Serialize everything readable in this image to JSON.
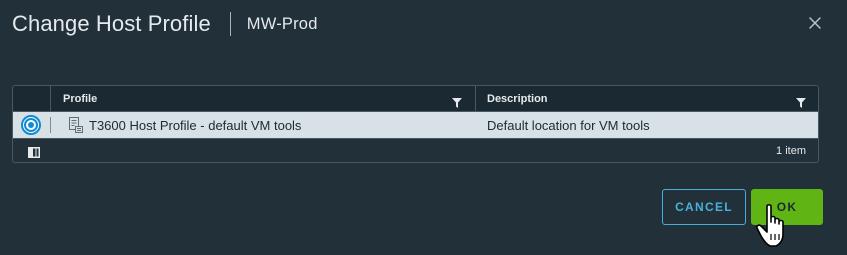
{
  "dialog": {
    "title": "Change Host Profile",
    "subtitle": "MW-Prod",
    "close_icon": "close-icon"
  },
  "grid": {
    "columns": [
      {
        "label": "Profile",
        "filter_icon": "filter-icon"
      },
      {
        "label": "Description",
        "filter_icon": "filter-icon"
      }
    ],
    "rows": [
      {
        "selected": true,
        "icon": "host-profile-icon",
        "profile": "T3600 Host Profile - default VM tools",
        "description": "Default location for VM tools"
      }
    ],
    "footer": {
      "columns_toggle_icon": "column-toggle-icon",
      "item_count": "1 item"
    }
  },
  "buttons": {
    "cancel": "CANCEL",
    "ok": "OK"
  },
  "colors": {
    "background": "#223039",
    "accent": "#49afd9",
    "primary": "#60b515",
    "selected_row": "#d8e1e6"
  }
}
